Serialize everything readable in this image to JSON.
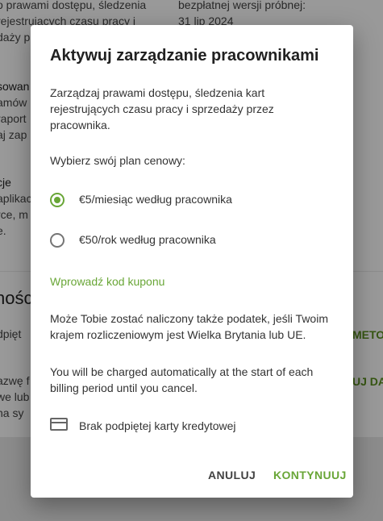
{
  "background": {
    "left_lines": [
      "o prawami dostępu, śledzenia",
      "rejestrujących czasu pracy i",
      "daży prz"
    ],
    "right_lines": [
      "bezpłatnej wersji próbnej:",
      "31 lip 2024"
    ],
    "section1_title": "sowan",
    "section1_lines": [
      "amów",
      "raport",
      "aj zap"
    ],
    "section2_title": "cje",
    "section2_lines": [
      "aplikac",
      "rce, m",
      "e."
    ],
    "section3_heading": "nośc",
    "section3_line": "dpięt",
    "right_link1": "METO",
    "section4_lines": [
      "azwę f",
      "we lub",
      "na sy"
    ],
    "right_link2": "UJ DA"
  },
  "dialog": {
    "title": "Aktywuj zarządzanie pracownikami",
    "description": "Zarządzaj prawami dostępu, śledzenia kart rejestrujących czasu pracy i sprzedaży przez pracownika.",
    "plan_prompt": "Wybierz swój plan cenowy:",
    "plans": [
      {
        "label": "€5/miesiąc według pracownika",
        "selected": true
      },
      {
        "label": "€50/rok według pracownika",
        "selected": false
      }
    ],
    "coupon_link": "Wprowadź kod kuponu",
    "tax_note": "Może Tobie zostać naliczony także podatek, jeśli Twoim krajem rozliczeniowym jest Wielka Brytania lub UE.",
    "billing_note": "You will be charged automatically at the start of each billing period until you cancel.",
    "card_icon": "credit-card-icon",
    "card_status": "Brak podpiętej karty kredytowej",
    "cancel_label": "ANULUJ",
    "continue_label": "KONTYNUUJ"
  },
  "colors": {
    "accent": "#69a637",
    "overlay": "rgba(0,0,0,0.4)"
  }
}
